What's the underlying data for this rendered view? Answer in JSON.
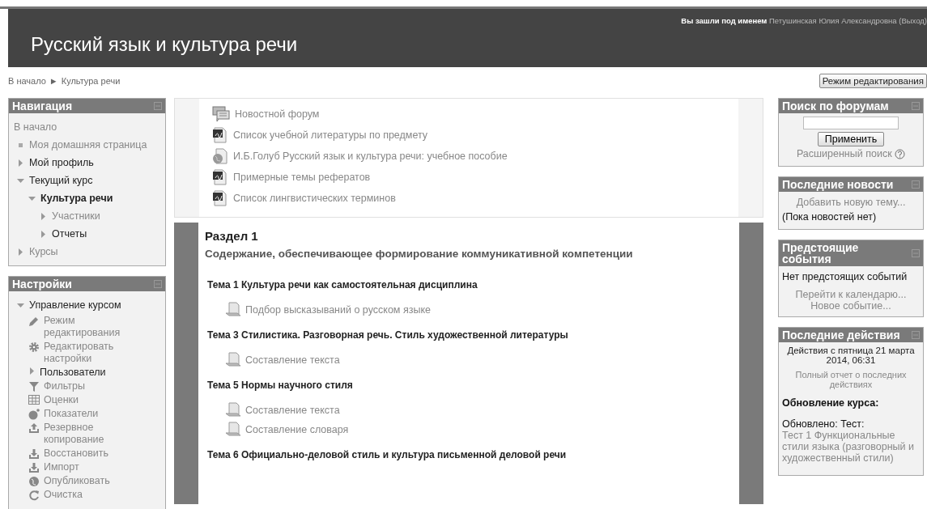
{
  "header": {
    "title": "Русский язык и культура речи",
    "login_prefix": "Вы зашли под именем",
    "user_name": "Петушинская Юлия Александровна",
    "logout": "(Выход)"
  },
  "breadcrumb": {
    "items": [
      "В начало",
      "Культура речи"
    ],
    "separator": "►"
  },
  "edit_button": "Режим редактирования",
  "navigation": {
    "title": "Навигация",
    "items": [
      {
        "label": "В начало",
        "kind": "plain",
        "link": true
      },
      {
        "label": "Моя домашняя страница",
        "kind": "leaf",
        "link": true
      },
      {
        "label": "Мой профиль",
        "kind": "branch",
        "expanded": false,
        "link": false
      },
      {
        "label": "Текущий курс",
        "kind": "branch",
        "expanded": true,
        "link": false,
        "children": [
          {
            "label": "Культура речи",
            "kind": "branch",
            "expanded": true,
            "link": false,
            "bold": true,
            "children": [
              {
                "label": "Участники",
                "kind": "branch",
                "expanded": false,
                "link": true
              },
              {
                "label": "Отчеты",
                "kind": "branch",
                "expanded": false,
                "link": false
              }
            ]
          }
        ]
      },
      {
        "label": "Курсы",
        "kind": "branch",
        "expanded": false,
        "link": true
      }
    ]
  },
  "settings": {
    "title": "Настройки",
    "root": {
      "label": "Управление курсом",
      "expanded": true
    },
    "items": [
      {
        "label": "Режим редактирования",
        "kind": "edit"
      },
      {
        "label": "Редактировать настройки",
        "kind": "settings"
      },
      {
        "label": "Пользователи",
        "kind": "branch"
      },
      {
        "label": "Фильтры",
        "kind": "filter"
      },
      {
        "label": "Оценки",
        "kind": "grades"
      },
      {
        "label": "Показатели",
        "kind": "outcomes"
      },
      {
        "label": "Резервное копирование",
        "kind": "backup"
      },
      {
        "label": "Восстановить",
        "kind": "restore"
      },
      {
        "label": "Импорт",
        "kind": "import"
      },
      {
        "label": "Опубликовать",
        "kind": "publish"
      },
      {
        "label": "Очистка",
        "kind": "reset"
      }
    ]
  },
  "general_resources": [
    {
      "label": "Новостной форум",
      "kind": "forum"
    },
    {
      "label": "Список учебной литературы по предмету",
      "kind": "pdf"
    },
    {
      "label": "И.Б.Голуб Русский язык и культура речи: учебное пособие",
      "kind": "web"
    },
    {
      "label": "Примерные темы рефератов",
      "kind": "pdf"
    },
    {
      "label": "Список лингвистических терминов",
      "kind": "pdf"
    }
  ],
  "section": {
    "title": "Раздел 1",
    "summary": "Содержание, обеспечивающее формирование коммуникативной компетенции",
    "topics": [
      {
        "title": "Тема 1 Культура речи как самостоятельная дисциплина",
        "activities": [
          "Подбор высказываний о русском языке"
        ]
      },
      {
        "title": "Тема 3 Стилистика. Разговорная речь. Стиль художественной литературы",
        "activities": [
          "Составление текста"
        ]
      },
      {
        "title": "Тема 5 Нормы научного стиля",
        "activities": [
          "Составление текста",
          "Составление словаря"
        ]
      },
      {
        "title": "Тема 6 Официально-деловой стиль и культура письменной деловой речи"
      }
    ]
  },
  "forum_search": {
    "title": "Поиск по форумам",
    "button": "Применить",
    "advanced": "Расширенный поиск"
  },
  "latest_news": {
    "title": "Последние новости",
    "add": "Добавить новую тему...",
    "empty": "(Пока новостей нет)"
  },
  "upcoming": {
    "title": "Предстоящие события",
    "empty": "Нет предстоящих событий",
    "links": [
      "Перейти к календарю...",
      "Новое событие..."
    ]
  },
  "recent": {
    "title": "Последние действия",
    "since": "Действия с пятница 21 марта 2014, 06:31",
    "report": "Полный отчет о последних действиях",
    "heading": "Обновление курса:",
    "updated": "Обновлено: Тест:",
    "item": "Тест 1 Функциональные стили языка (разговорный и художественный стили)"
  }
}
